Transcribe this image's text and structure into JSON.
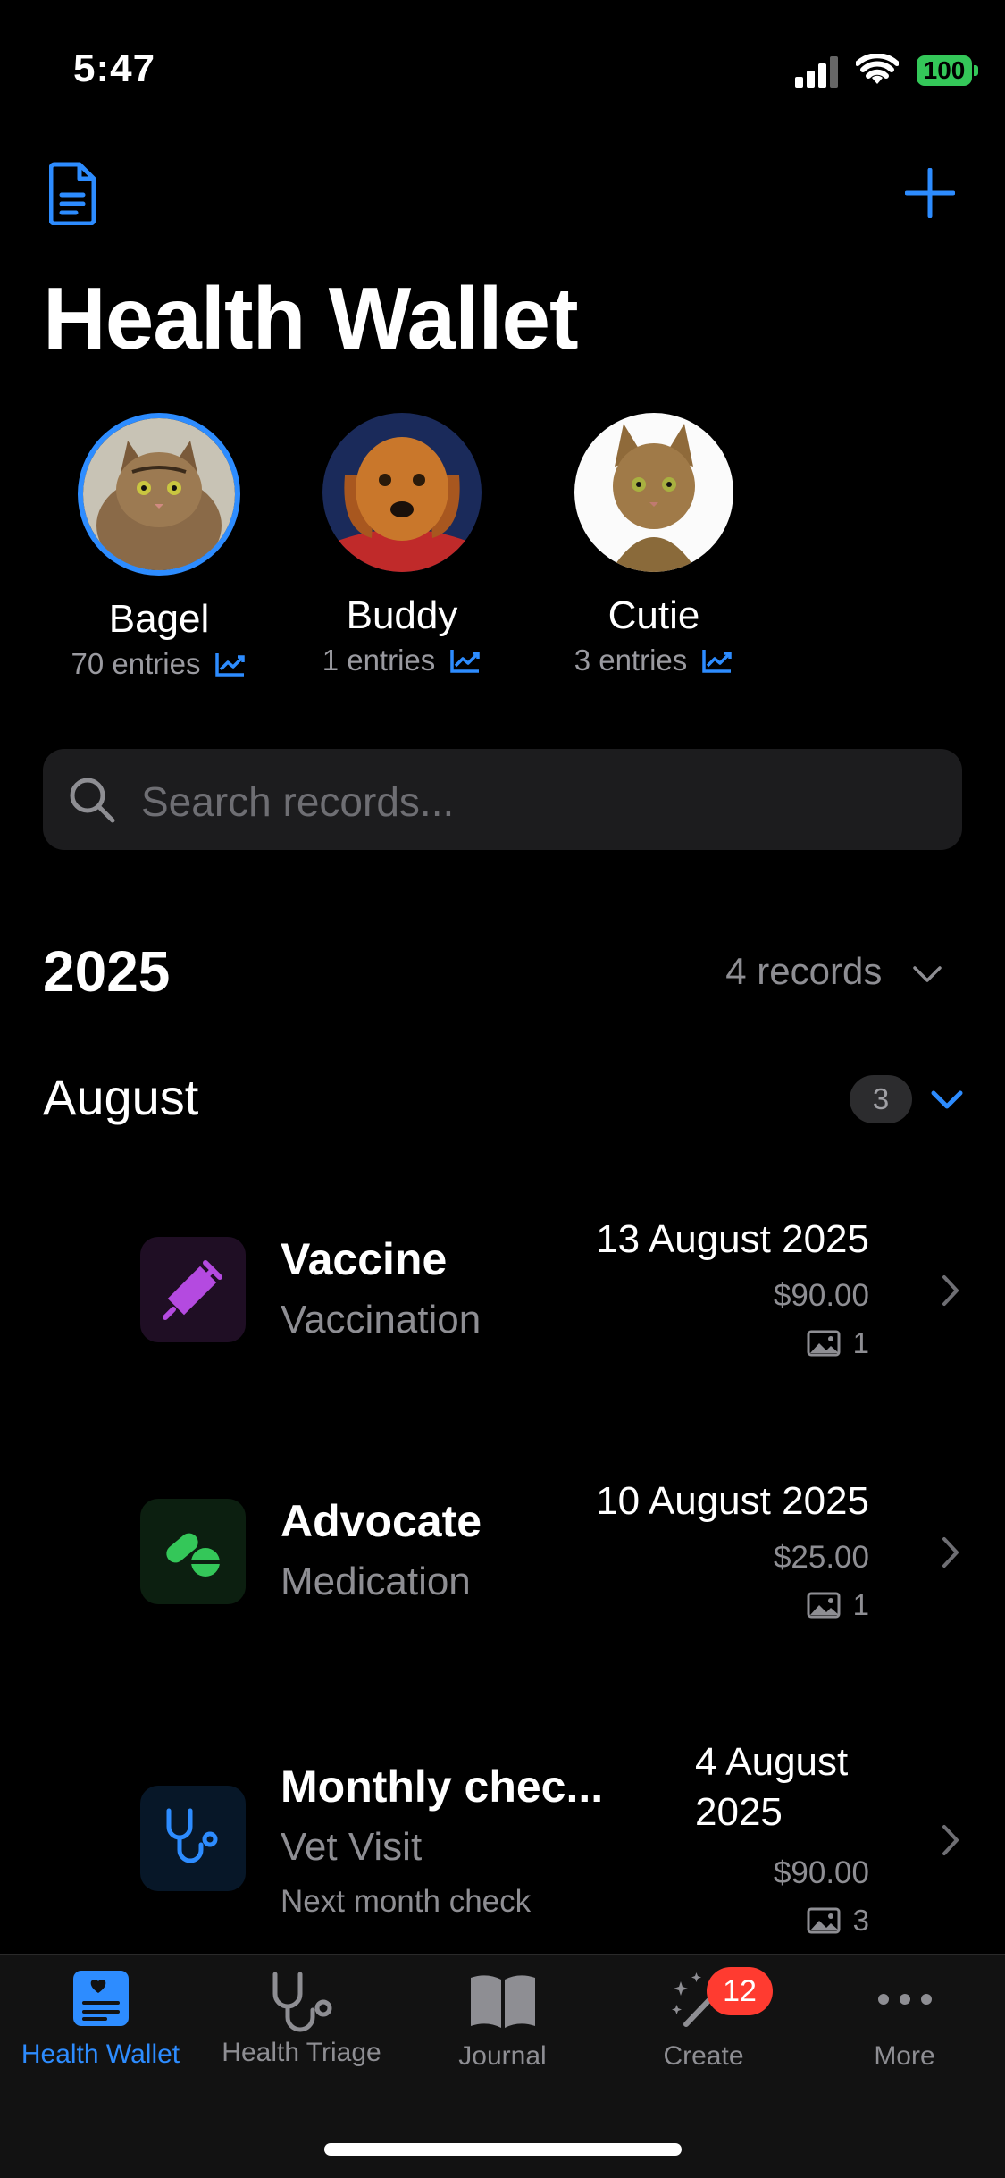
{
  "status": {
    "time": "5:47",
    "battery": "100"
  },
  "header": {
    "title": "Health Wallet"
  },
  "pets": [
    {
      "name": "Bagel",
      "entries": "70 entries"
    },
    {
      "name": "Buddy",
      "entries": "1 entries"
    },
    {
      "name": "Cutie",
      "entries": "3 entries"
    }
  ],
  "search": {
    "placeholder": "Search records..."
  },
  "year_section": {
    "year": "2025",
    "count": "4 records"
  },
  "month_section": {
    "month": "August",
    "count": "3"
  },
  "records": [
    {
      "title": "Vaccine",
      "type": "Vaccination",
      "date": "13 August 2025",
      "price": "$90.00",
      "photos": "1"
    },
    {
      "title": "Advocate",
      "type": "Medication",
      "date": "10 August 2025",
      "price": "$25.00",
      "photos": "1"
    },
    {
      "title": "Monthly chec...",
      "type": "Vet Visit",
      "note": "Next month check",
      "date_line1": "4 August",
      "date_line2": "2025",
      "price": "$90.00",
      "photos": "3"
    }
  ],
  "tabs": [
    {
      "label": "Health Wallet"
    },
    {
      "label": "Health Triage"
    },
    {
      "label": "Journal"
    },
    {
      "label": "Create",
      "badge": "12"
    },
    {
      "label": "More"
    }
  ],
  "colors": {
    "accent": "#2d8cff",
    "vaccine_icon": "#b44ae0",
    "medication_icon": "#34c759",
    "battery": "#34c759",
    "badge": "#ff3b30"
  }
}
